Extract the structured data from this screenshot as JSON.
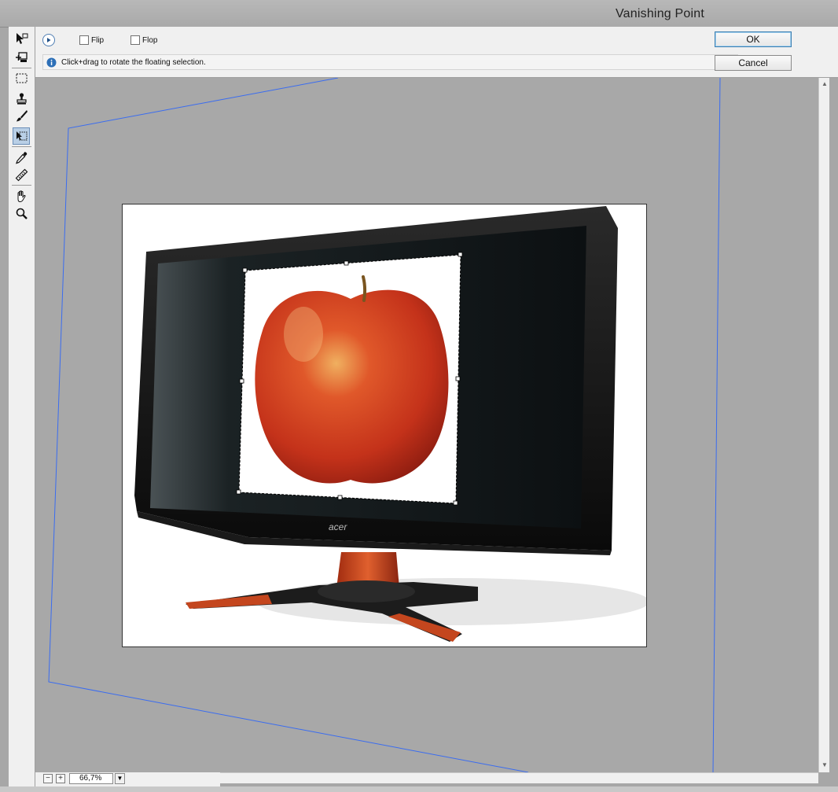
{
  "window": {
    "title": "Vanishing Point"
  },
  "tools": [
    {
      "name": "edit-plane-tool-icon"
    },
    {
      "name": "create-plane-tool-icon"
    },
    {
      "name": "marquee-tool-icon"
    },
    {
      "name": "stamp-tool-icon"
    },
    {
      "name": "brush-tool-icon"
    },
    {
      "name": "transform-tool-icon",
      "active": true
    },
    {
      "name": "eyedropper-tool-icon"
    },
    {
      "name": "measure-tool-icon"
    },
    {
      "name": "hand-tool-icon"
    },
    {
      "name": "zoom-tool-icon"
    }
  ],
  "options": {
    "flip_label": "Flip",
    "flop_label": "Flop",
    "info_text": "Click+drag to rotate the floating selection."
  },
  "buttons": {
    "ok_label": "OK",
    "cancel_label": "Cancel"
  },
  "status": {
    "zoom_out_symbol": "−",
    "zoom_in_symbol": "+",
    "zoom_value": "66,7%"
  },
  "monitor": {
    "brand": "acer"
  },
  "colors": {
    "plane_grid": "#3a6cf0",
    "accent": "#3c7fb1"
  }
}
